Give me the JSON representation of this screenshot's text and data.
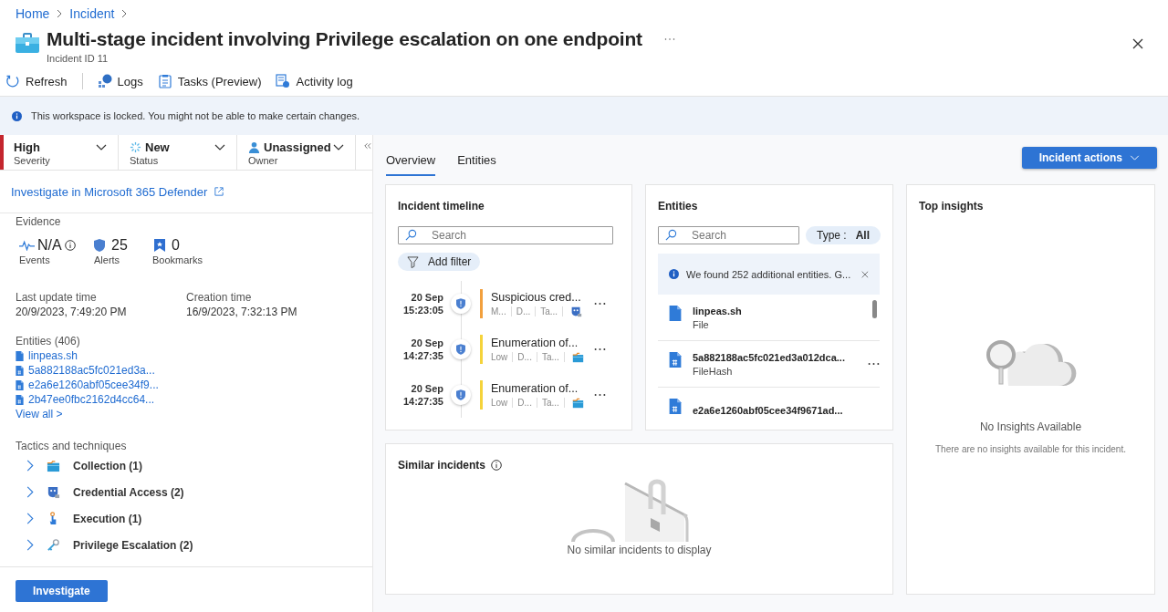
{
  "breadcrumb": [
    {
      "label": "Home"
    },
    {
      "label": "Incident"
    }
  ],
  "header": {
    "title": "Multi-stage incident involving Privilege escalation on one endpoint",
    "subtitle": "Incident ID 11"
  },
  "toolbar": [
    {
      "label": "Refresh",
      "kind": "refresh"
    },
    {
      "label": "Logs",
      "kind": "logs"
    },
    {
      "label": "Tasks (Preview)",
      "kind": "tasks"
    },
    {
      "label": "Activity log",
      "kind": "activity"
    }
  ],
  "notice": "This workspace is locked. You might not be able to make certain changes.",
  "fields": [
    {
      "value": "High",
      "label": "Severity",
      "kind": "severity"
    },
    {
      "value": "New",
      "label": "Status",
      "kind": "status"
    },
    {
      "value": "Unassigned",
      "label": "Owner",
      "kind": "owner"
    }
  ],
  "external_link": "Investigate in Microsoft 365 Defender",
  "evidence": {
    "title": "Evidence",
    "stats": [
      {
        "value": "N/A",
        "label": "Events",
        "kind": "events"
      },
      {
        "value": "25",
        "label": "Alerts",
        "kind": "alerts"
      },
      {
        "value": "0",
        "label": "Bookmarks",
        "kind": "bookmarks"
      }
    ]
  },
  "times": [
    {
      "label": "Last update time",
      "value": "20/9/2023, 7:49:20 PM"
    },
    {
      "label": "Creation time",
      "value": "16/9/2023, 7:32:13 PM"
    }
  ],
  "entities_summary": {
    "title": "Entities (406)",
    "items": [
      {
        "name": "linpeas.sh",
        "kind": "file"
      },
      {
        "name": "5a882188ac5fc021ed3a...",
        "kind": "hash"
      },
      {
        "name": "e2a6e1260abf05cee34f9...",
        "kind": "hash"
      },
      {
        "name": "2b47ee0fbc2162d4cc64...",
        "kind": "hash"
      }
    ],
    "view_all": "View all >"
  },
  "tactics": {
    "title": "Tactics and techniques",
    "items": [
      {
        "label": "Collection (1)",
        "kind": "collection"
      },
      {
        "label": "Credential Access (2)",
        "kind": "credential"
      },
      {
        "label": "Execution (1)",
        "kind": "execution"
      },
      {
        "label": "Privilege Escalation (2)",
        "kind": "privilege"
      }
    ]
  },
  "investigate_button": "Investigate",
  "tabs": [
    {
      "label": "Overview",
      "selected": true
    },
    {
      "label": "Entities",
      "selected": false
    }
  ],
  "incident_actions": "Incident actions",
  "timeline": {
    "title": "Incident timeline",
    "search_placeholder": "Search",
    "filter": "Add filter",
    "items": [
      {
        "date": "20 Sep",
        "time": "15:23:05",
        "color": "#f2a03d",
        "title": "Suspicious cred...",
        "meta": [
          "M...",
          "D...",
          "Ta..."
        ],
        "kind": "credential"
      },
      {
        "date": "20 Sep",
        "time": "14:27:35",
        "color": "#f5d33b",
        "title": "Enumeration of...",
        "meta": [
          "Low",
          "D...",
          "Ta..."
        ],
        "kind": "collection"
      },
      {
        "date": "20 Sep",
        "time": "14:27:35",
        "color": "#f5d33b",
        "title": "Enumeration of...",
        "meta": [
          "Low",
          "D...",
          "Ta..."
        ],
        "kind": "collection"
      }
    ]
  },
  "entities_card": {
    "title": "Entities",
    "search_placeholder": "Search",
    "type_filter": "Type : **All**",
    "notice": "We found 252 additional entities. G...",
    "items": [
      {
        "name": "linpeas.sh",
        "type": "File",
        "kind": "file"
      },
      {
        "name": "5a882188ac5fc021ed3a012dca...",
        "type": "FileHash",
        "kind": "hash"
      },
      {
        "name": "e2a6e1260abf05cee34f9671ad...",
        "kind": "hash"
      }
    ]
  },
  "similar": {
    "title": "Similar incidents",
    "empty": "No similar incidents to display"
  },
  "insights": {
    "title": "Top insights",
    "empty_title": "No Insights Available",
    "empty_text": "There are no insights available for this incident."
  }
}
